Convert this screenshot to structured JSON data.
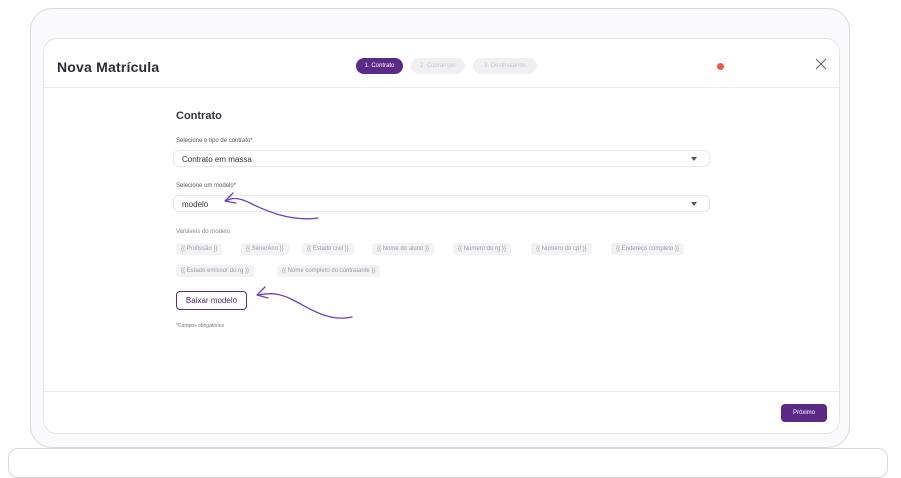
{
  "modal": {
    "title": "Nova Matrícula",
    "steps": [
      {
        "label": "1. Contrato",
        "active": true
      },
      {
        "label": "2. Cobranças",
        "active": false
      },
      {
        "label": "3. Destinatários",
        "active": false
      }
    ],
    "notification_color": "#f05a44"
  },
  "form": {
    "section_title": "Contrato",
    "contract_type": {
      "label": "Selecione o tipo de contrato*",
      "value": "Contrato em massa"
    },
    "model": {
      "label": "Selecione um modelo*",
      "value": "modelo"
    },
    "variables": {
      "label": "Variáveis do modelo",
      "tags": [
        "{{ Profissão }}",
        "{{ Série/Ano }}",
        "{{ Estado civil }}",
        "{{ Nome do aluno }}",
        "{{ Número do rg }}",
        "{{ Número do cpf }}",
        "{{ Endereço completo }}",
        "{{ Estado emissor do rg }}",
        "{{ Nome completo do contratante }}"
      ]
    },
    "download_button": "Baixar modelo",
    "required_note": "*Campos obrigatórios"
  },
  "footer": {
    "next_button": "Próximo"
  },
  "colors": {
    "accent": "#5b2a86",
    "annotation": "#6a3fc4"
  }
}
